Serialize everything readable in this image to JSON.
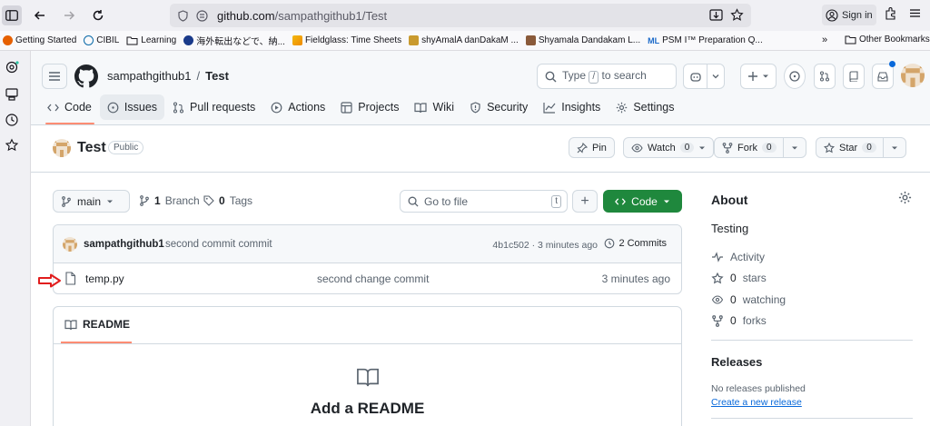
{
  "browser": {
    "url_host": "github.com",
    "url_path": "/sampathgithub1/Test",
    "signin_label": "Sign in"
  },
  "bookmarks": {
    "items": [
      "Getting Started",
      "CIBIL",
      "Learning",
      "海外転出などで、納...",
      "Fieldglass: Time Sheets",
      "shyAmalA danDakaM ...",
      "Shyamala Dandakam L...",
      "PSM I™ Preparation Q..."
    ],
    "ml_prefix": "ML",
    "more_label": "»",
    "other_label": "Other Bookmarks"
  },
  "header": {
    "owner": "sampathgithub1",
    "separator": "/",
    "repo": "Test",
    "search_before": "Type",
    "search_key": "/",
    "search_after": "to search"
  },
  "repo_nav": {
    "tabs": [
      "Code",
      "Issues",
      "Pull requests",
      "Actions",
      "Projects",
      "Wiki",
      "Security",
      "Insights",
      "Settings"
    ]
  },
  "repo_title": {
    "name": "Test",
    "visibility": "Public",
    "pin_label": "Pin",
    "watch_label": "Watch",
    "watch_count": "0",
    "fork_label": "Fork",
    "fork_count": "0",
    "star_label": "Star",
    "star_count": "0"
  },
  "file_nav": {
    "branch": "main",
    "branch_count": "1",
    "branch_label": "Branch",
    "tag_count": "0",
    "tag_label": "Tags",
    "goto_placeholder": "Go to file",
    "goto_key": "t",
    "plus_label": "+",
    "code_label": "Code"
  },
  "latest_commit": {
    "author": "sampathgithub1",
    "message": "second commit commit",
    "hash_time": "4b1c502 · 3 minutes ago",
    "commits_label": "2 Commits"
  },
  "files": [
    {
      "name": "temp.py",
      "message": "second change commit",
      "age": "3 minutes ago"
    }
  ],
  "readme": {
    "tab_label": "README",
    "title": "Add a README"
  },
  "about": {
    "title": "About",
    "description": "Testing",
    "activity": "Activity",
    "stars_count": "0",
    "stars_label": "stars",
    "watching_count": "0",
    "watching_label": "watching",
    "forks_count": "0",
    "forks_label": "forks"
  },
  "releases": {
    "title": "Releases",
    "none_text": "No releases published",
    "create_link": "Create a new release"
  },
  "colors": {
    "accent_green": "#1f883d",
    "tab_underline": "#fd8c73",
    "link_blue": "#0969da",
    "arrow_red": "#e11d1d"
  }
}
